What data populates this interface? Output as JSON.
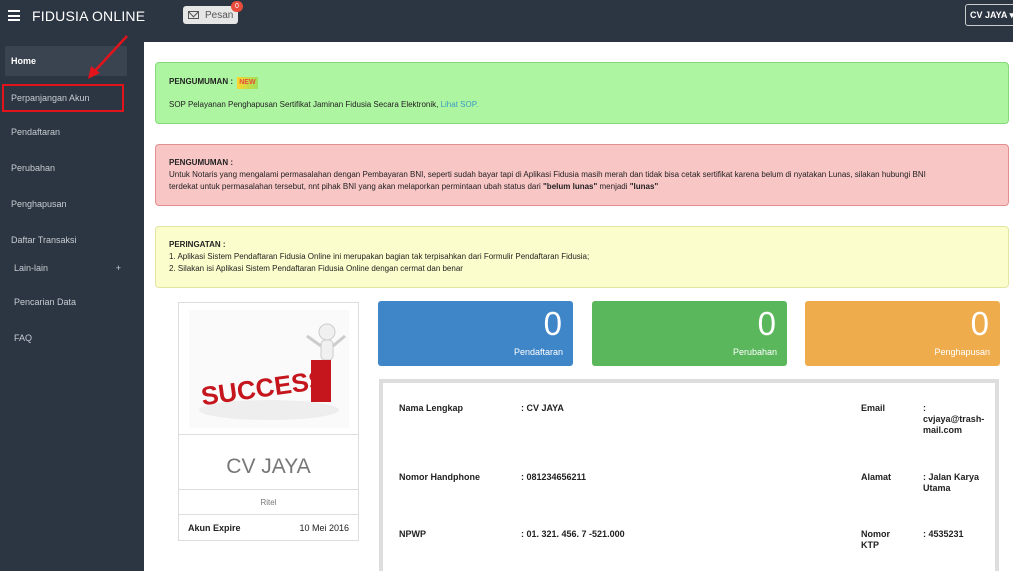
{
  "app": {
    "title": "FIDUSIA ONLINE"
  },
  "topbar": {
    "pesan_label": "Pesan",
    "pesan_count": "0",
    "user_label": "CV JAYA"
  },
  "sidebar": {
    "items": [
      {
        "label": "Home"
      },
      {
        "label": "Perpanjangan Akun"
      },
      {
        "label": "Pendaftaran"
      },
      {
        "label": "Perubahan"
      },
      {
        "label": "Penghapusan"
      },
      {
        "label": "Daftar Transaksi"
      },
      {
        "label": "Lain-lain",
        "expand": "+"
      },
      {
        "label": "Pencarian Data"
      },
      {
        "label": "FAQ"
      }
    ]
  },
  "announcements": {
    "green": {
      "title": "PENGUMUMAN :",
      "tag": "NEW",
      "text": "SOP Pelayanan Penghapusan Sertifikat Jaminan Fidusia Secara Elektronik, ",
      "link": "Lihat SOP."
    },
    "red": {
      "title": "PENGUMUMAN :",
      "text1": "Untuk Notaris yang mengalami permasalahan dengan Pembayaran BNI, seperti sudah bayar tapi di Aplikasi Fidusia masih merah dan tidak bisa cetak sertifikat karena belum di nyatakan Lunas, silakan hubungi BNI",
      "text2": "terdekat untuk permasalahan tersebut, nnt pihak BNI yang akan melaporkan permintaan ubah status dari ",
      "status_from": "\"belum lunas\"",
      "mid": " menjadi ",
      "status_to": "\"lunas\""
    },
    "yellow": {
      "title": "PERINGATAN :",
      "line1": "1. Aplikasi Sistem Pendaftaran Fidusia Online ini merupakan bagian tak terpisahkan dari Formulir Pendaftaran Fidusia;",
      "line2": "2. Silakan isi Aplikasi Sistem Pendaftaran Fidusia Online dengan cermat dan benar"
    }
  },
  "profile": {
    "image_text": "SUCCESS",
    "name": "CV JAYA",
    "type": "Ritel",
    "expire_label": "Akun Expire",
    "expire_value": "10 Mei 2016"
  },
  "stats": [
    {
      "value": "0",
      "label": "Pendaftaran",
      "color": "#3e86c8"
    },
    {
      "value": "0",
      "label": "Perubahan",
      "color": "#5bb75b"
    },
    {
      "value": "0",
      "label": "Penghapusan",
      "color": "#eeac4d"
    }
  ],
  "info": {
    "nama_label": "Nama Lengkap",
    "nama_value": ": CV JAYA",
    "email_label": "Email",
    "email_value_1": ":",
    "email_value_2": "cvjaya@trash-",
    "email_value_3": "mail.com",
    "hp_label": "Nomor Handphone",
    "hp_value": ": 081234656211",
    "alamat_label": "Alamat",
    "alamat_value_1": ": Jalan Karya",
    "alamat_value_2": "Utama",
    "npwp_label": "NPWP",
    "npwp_value": ": 01. 321. 456. 7 -521.000",
    "ktp_label_1": "Nomor",
    "ktp_label_2": "KTP",
    "ktp_value": ": 4535231"
  }
}
